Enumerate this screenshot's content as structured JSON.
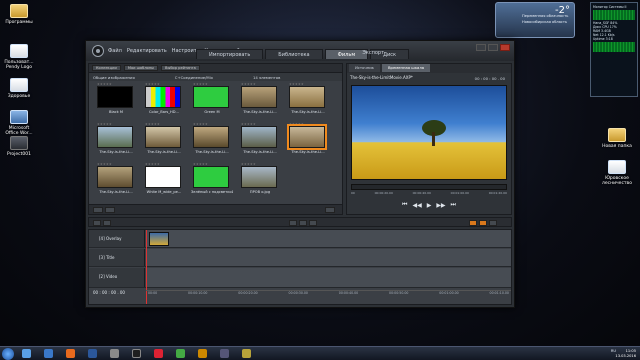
{
  "desktop": {
    "icons_left": [
      {
        "label": "Программы",
        "icon": "folder-icon"
      },
      {
        "label": "Пользоват... Pendy Logo",
        "icon": "document-icon"
      },
      {
        "label": "Здоровье",
        "icon": "document-icon"
      },
      {
        "label": "Microsoft Office Wor...",
        "icon": "word-icon"
      },
      {
        "label": "Project001",
        "icon": "app-icon"
      }
    ],
    "icons_right": [
      {
        "label": "Новая папка",
        "icon": "folder-icon"
      },
      {
        "label": "Юровское лесничество",
        "icon": "document-icon"
      }
    ]
  },
  "weather_gadget": {
    "temperature": "-2°",
    "line1": "Переменная облачность",
    "line2": "Новосибирская область"
  },
  "monitor_gadget": {
    "title": "Монитор Системы II",
    "rows": [
      "Hana_SGF 84%",
      "Диск CPU 17%",
      "RAM 3.4GB",
      "Net 12.1 Kb/s",
      "Uptime 3:18"
    ]
  },
  "app": {
    "menu": [
      "Файл",
      "Редактировать",
      "Настроить",
      "Установки",
      "?"
    ],
    "tabs": [
      "Импортировать",
      "Библиотека",
      "Фильм",
      "Диск"
    ],
    "active_tab": "Фильм",
    "export_label": "Экспорт",
    "library": {
      "toolbar": [
        "Коллекции",
        "Мои шаблоны",
        "Выбор рейтинга"
      ],
      "subbar_left": "Общие изображения",
      "subbar_mid": "С+Соединение/Mix",
      "subbar_right": "14 элементов",
      "thumbs": [
        {
          "caption": "Black M",
          "color": "#000000"
        },
        {
          "caption": "Color_Bars_HD...",
          "color": "bars"
        },
        {
          "caption": "Green M",
          "color": "#2ecc40"
        },
        {
          "caption": "The-Sky-is-the-Li...",
          "color": "photo1"
        },
        {
          "caption": "The-Sky-is-the-Li...",
          "color": "photo2"
        },
        {
          "caption": "The-Sky-is-the-Li...",
          "color": "photo3"
        },
        {
          "caption": "The-Sky-is-the-Li...",
          "color": "photo4"
        },
        {
          "caption": "The-Sky-is-the-Li...",
          "color": "photo5"
        },
        {
          "caption": "The-Sky-is-the-Li...",
          "color": "photo6"
        },
        {
          "caption": "The-Sky-is-the-Li...",
          "color": "photo7"
        },
        {
          "caption": "The-Sky-is-the-Li...",
          "color": "photo8"
        },
        {
          "caption": "White M_wide_pe...",
          "color": "#ffffff"
        },
        {
          "caption": "Зелёный с подсветкой",
          "color": "#2ecc40"
        },
        {
          "caption": "ПРОВ о.jpg",
          "color": "photo9"
        }
      ],
      "selected_index": 9
    },
    "player": {
      "tabs": [
        "Источник",
        "Временная шкала"
      ],
      "active_tab": "Временная шкала",
      "title": "The-Sky-is-the-LimitMovie.AXP*",
      "timecode": "00 : 00 : 00 . 00",
      "scrub_labels": [
        "00",
        "00:00:20.00",
        "00:00:40.00",
        "00:01:00.00",
        "00:01:20.00"
      ],
      "transport": [
        "⏮",
        "◀◀",
        "▶",
        "▶▶",
        "⏭"
      ]
    },
    "timeline": {
      "tracks": [
        {
          "name": "[4] Overlay"
        },
        {
          "name": "[3] Title"
        },
        {
          "name": "[2] Video"
        }
      ],
      "current_time": "00 : 00 : 00 . 00",
      "ruler": [
        "00:00",
        "00:00:10.00",
        "00:00:20.00",
        "00:00:30.00",
        "00:00:40.00",
        "00:00:50.00",
        "00:01:00.00",
        "00:01:10.00"
      ]
    }
  },
  "taskbar": {
    "tray_lang": "RU",
    "time": "11:05",
    "date": "13.03.2016"
  }
}
